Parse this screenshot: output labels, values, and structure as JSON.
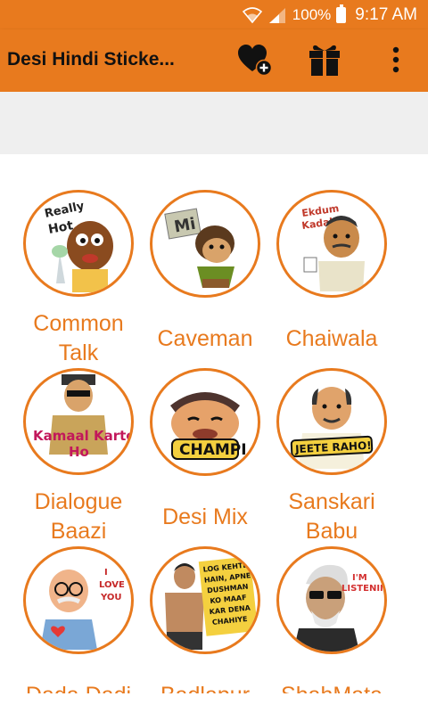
{
  "status_bar": {
    "battery": "100%",
    "time": "9:17 AM"
  },
  "app_bar": {
    "title": "Desi Hindi Sticke..."
  },
  "colors": {
    "primary": "#e87a1e",
    "banner": "#efefef"
  },
  "icons": {
    "favorite_add": "heart-plus-icon",
    "gift": "gift-icon",
    "more": "more-vert-icon",
    "wifi": "wifi-icon",
    "signal": "signal-icon",
    "battery": "battery-icon"
  },
  "categories": [
    {
      "label": "Common Talk",
      "sticker_text": [
        "Really",
        "Hot"
      ]
    },
    {
      "label": "Caveman",
      "sticker_text": [
        "Mi"
      ]
    },
    {
      "label": "Chaiwala",
      "sticker_text": [
        "Ekdum",
        "Kadak"
      ]
    },
    {
      "label": "Dialogue Baazi",
      "sticker_text": [
        "Kamaal Karte",
        "Ho"
      ]
    },
    {
      "label": "Desi Mix",
      "sticker_text": [
        "CHAMPI"
      ]
    },
    {
      "label": "Sanskari Babu",
      "sticker_text": [
        "JEETE RAHO!"
      ]
    },
    {
      "label": "Dada Dadi",
      "sticker_text": [
        "I",
        "LOVE",
        "YOU"
      ]
    },
    {
      "label": "Badlapur",
      "sticker_text": [
        "LOG KEHTE",
        "HAIN, APNE",
        "DUSHMAN",
        "KO MAAF",
        "KAR DENA",
        "CHAHIYE"
      ]
    },
    {
      "label": "ShahMata",
      "sticker_text": [
        "I'M",
        "LISTENING"
      ]
    }
  ]
}
